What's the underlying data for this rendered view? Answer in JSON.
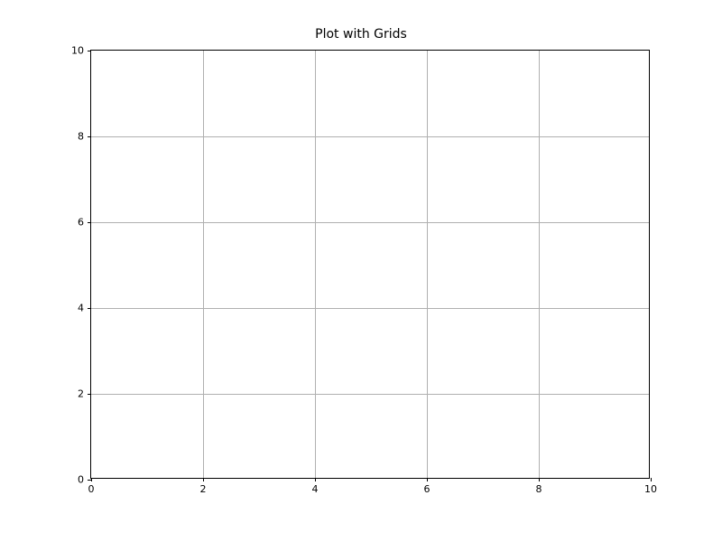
{
  "chart_data": {
    "type": "line",
    "title": "Plot with Grids",
    "xlabel": "",
    "ylabel": "",
    "xlim": [
      0,
      10
    ],
    "ylim": [
      0,
      10
    ],
    "xticks": [
      0,
      2,
      4,
      6,
      8,
      10
    ],
    "yticks": [
      0,
      2,
      4,
      6,
      8,
      10
    ],
    "grid": true,
    "series": []
  }
}
